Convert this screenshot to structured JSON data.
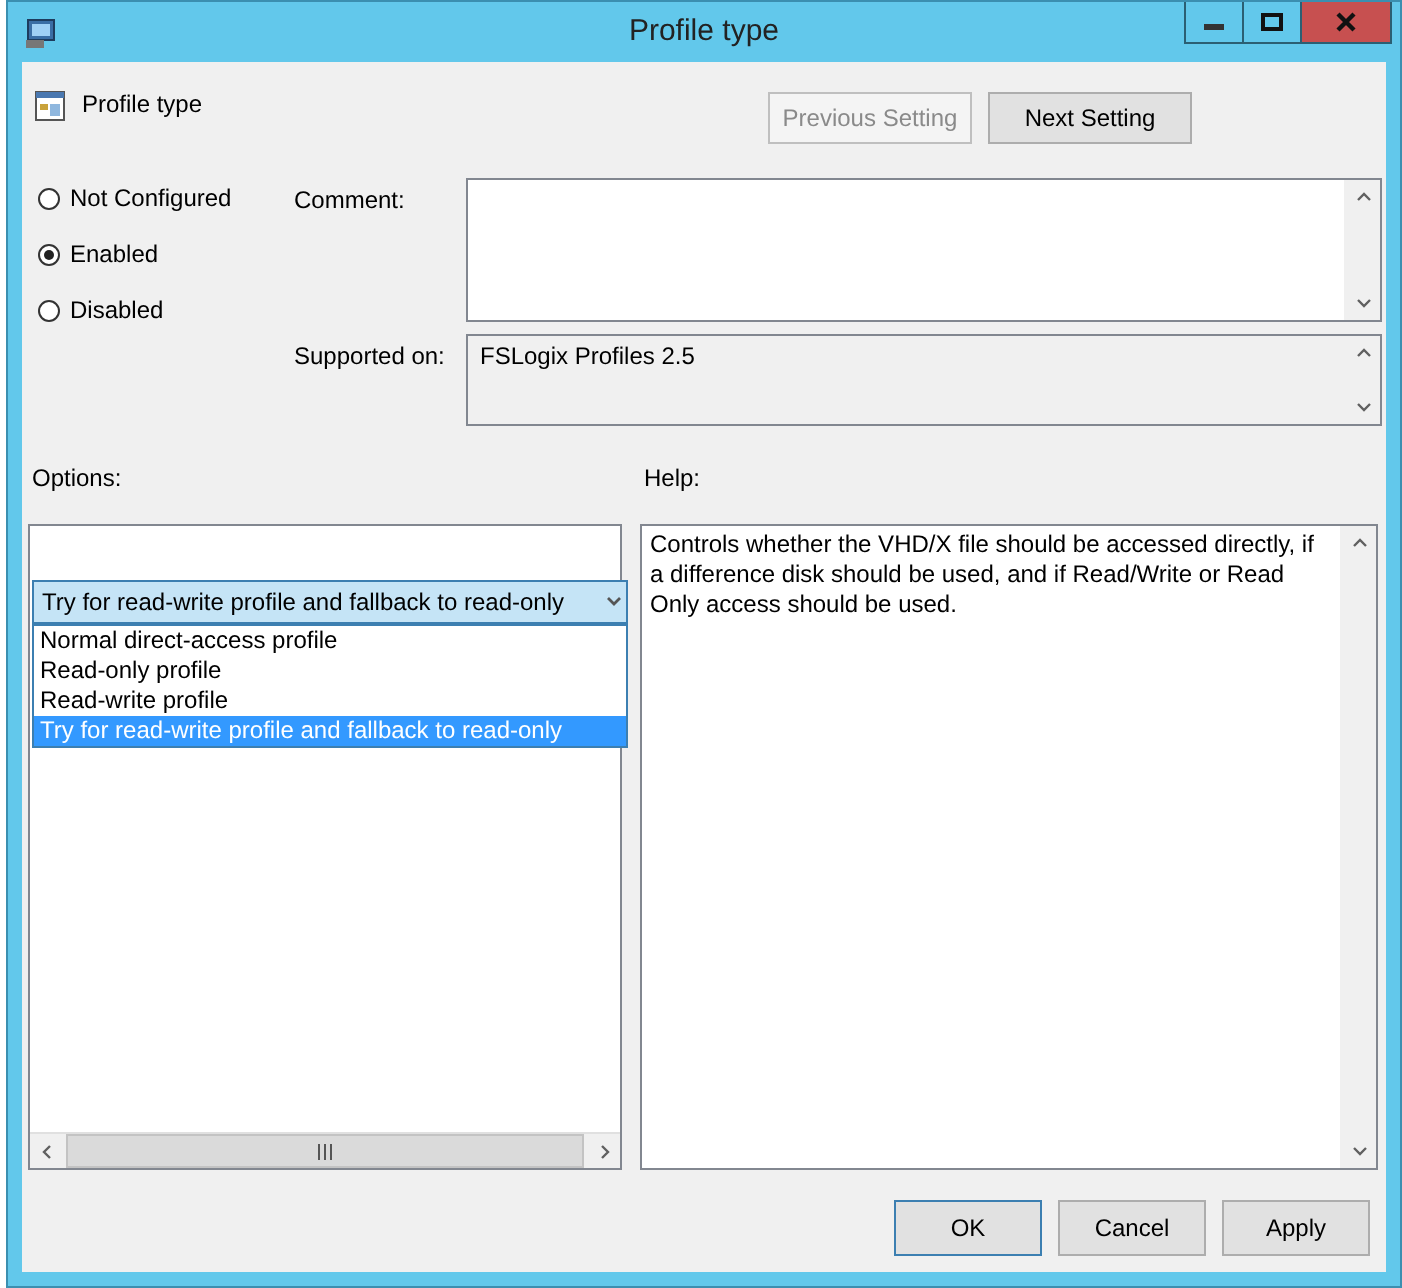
{
  "window": {
    "title": "Profile type"
  },
  "setting": {
    "title": "Profile type"
  },
  "nav_buttons": [
    {
      "label": "Previous Setting",
      "disabled": true
    },
    {
      "label": "Next Setting",
      "disabled": false
    }
  ],
  "state_options": [
    {
      "label": "Not Configured",
      "selected": false
    },
    {
      "label": "Enabled",
      "selected": true
    },
    {
      "label": "Disabled",
      "selected": false
    }
  ],
  "comment": {
    "label": "Comment:"
  },
  "supported_on": {
    "label": "Supported on:",
    "value": "FSLogix Profiles 2.5"
  },
  "options": {
    "label": "Options:",
    "dropdown": {
      "value": "Try for read-write profile and fallback to read-only",
      "expanded": true,
      "items": [
        {
          "label": "Normal direct-access profile",
          "selected": false
        },
        {
          "label": "Read-only profile",
          "selected": false
        },
        {
          "label": "Read-write profile",
          "selected": false
        },
        {
          "label": "Try for read-write profile and fallback to read-only",
          "selected": true
        }
      ]
    }
  },
  "help": {
    "label": "Help:",
    "text": "Controls whether the VHD/X file should be accessed directly, if a difference disk should be used, and if Read/Write or Read Only access should be used."
  },
  "buttons": [
    {
      "label": "OK",
      "default": true
    },
    {
      "label": "Cancel",
      "default": false
    },
    {
      "label": "Apply",
      "default": false
    }
  ]
}
